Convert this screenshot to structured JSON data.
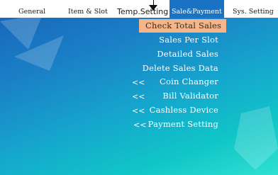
{
  "tabs": [
    {
      "label": "General"
    },
    {
      "label": "Item & Slot"
    },
    {
      "label": "Temp.Setting"
    },
    {
      "label": "Sale&Payment"
    },
    {
      "label": "Sys. Setting"
    }
  ],
  "active_tab": "Sale&Payment",
  "menu": [
    {
      "label": "Check Total Sales",
      "selected": true
    },
    {
      "label": "Sales Per Slot"
    },
    {
      "label": "Detailed Sales"
    },
    {
      "label": "Delete Sales Data"
    },
    {
      "label": "Coin Changer",
      "prefix": "<<"
    },
    {
      "label": "Bill Validator",
      "prefix": "<<"
    },
    {
      "label": "Cashless Device",
      "prefix": "<<"
    },
    {
      "label": "Payment Setting",
      "prefix": "<<"
    }
  ],
  "colors": {
    "tab_active_bg": "#1a72c4",
    "selected_bg": "#f4b58a"
  }
}
